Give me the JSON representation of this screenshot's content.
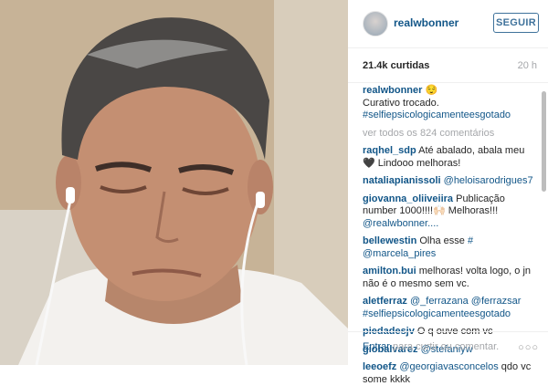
{
  "post": {
    "username": "realwbonner",
    "follow_label": "SEGUIR",
    "likes": "21.4k curtidas",
    "time": "20 h",
    "caption": {
      "user": "realwbonner",
      "emoji": "😌",
      "line1": "Curativo trocado.",
      "hashtag": "#selfiepsicologicamenteesgotado"
    },
    "view_all": "ver todos os 824 comentários"
  },
  "comments": [
    {
      "user": "raqhel_sdp",
      "text": " Até abalado, abala meu 🖤 Lindooo melhoras!"
    },
    {
      "user": "nataliapianissoli",
      "mention": " @heloisarodrigues7"
    },
    {
      "user": "giovanna_oliiveiira",
      "text": " Publicação number 1000!!!!🙌🏻 Melhoras!!! ",
      "mention": "@realwbonner...."
    },
    {
      "user": "bellewestin",
      "text": " Olha esse ",
      "mention": "# @marcela_pires"
    },
    {
      "user": "amilton.bui",
      "text": " melhoras! volta logo, o jn não é o mesmo sem vc."
    },
    {
      "user": "aletferraz",
      "mention": " @_ferrazana @ferrazsar #selfiepsicologicamenteesgotado"
    },
    {
      "user": "piedadesjv",
      "text": " O q ouve com vc"
    },
    {
      "user": "giobalvarez",
      "mention": " @stefaniyw"
    },
    {
      "user": "leeoefz",
      "mention": " @georgiavasconcelos",
      "text": " qdo vc some kkkk"
    }
  ],
  "footer": {
    "enter": "Entrar",
    "rest": " para curtir ou comentar."
  },
  "icons": {
    "more": "more-options-icon"
  }
}
